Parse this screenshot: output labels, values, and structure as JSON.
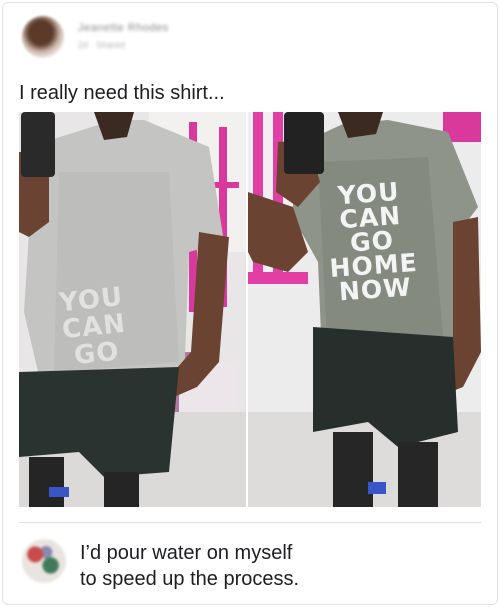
{
  "post": {
    "author_name": "Jeanette Rhodes",
    "meta": "2d · Shared",
    "text": "I really need this shirt..."
  },
  "photos": {
    "left_shirt_lines": [
      "YOU",
      "CAN",
      "GO"
    ],
    "right_shirt_lines": [
      "YOU",
      "CAN",
      "GO",
      "HOME",
      "NOW"
    ]
  },
  "reply": {
    "line1": "I’d pour water on myself",
    "line2": "to speed up the process."
  },
  "colors": {
    "text": "#1c1e21",
    "gym_pink": "#d9399b",
    "shirt_grey": "#9a9d97",
    "shirt_wet_grey": "#7c8078"
  }
}
